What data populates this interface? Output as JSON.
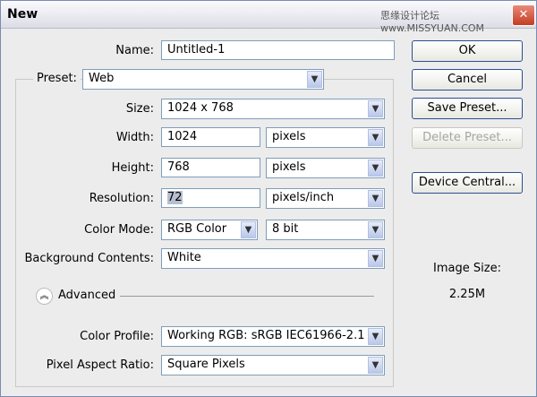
{
  "window": {
    "title": "New",
    "watermark": "思缘设计论坛 www.MISSYUAN.COM",
    "close": "✕"
  },
  "name": {
    "label": "Name:",
    "value": "Untitled-1"
  },
  "preset": {
    "label": "Preset:",
    "value": "Web"
  },
  "size": {
    "label": "Size:",
    "value": "1024 x 768"
  },
  "width": {
    "label": "Width:",
    "value": "1024",
    "unit": "pixels"
  },
  "height": {
    "label": "Height:",
    "value": "768",
    "unit": "pixels"
  },
  "resolution": {
    "label": "Resolution:",
    "value": "72",
    "unit": "pixels/inch"
  },
  "color_mode": {
    "label": "Color Mode:",
    "value": "RGB Color",
    "depth": "8 bit"
  },
  "background": {
    "label": "Background Contents:",
    "value": "White"
  },
  "advanced": {
    "label": "Advanced"
  },
  "color_profile": {
    "label": "Color Profile:",
    "value": "Working RGB:  sRGB IEC61966-2.1"
  },
  "pixel_aspect": {
    "label": "Pixel Aspect Ratio:",
    "value": "Square Pixels"
  },
  "buttons": {
    "ok": "OK",
    "cancel": "Cancel",
    "save_preset": "Save Preset...",
    "delete_preset": "Delete Preset...",
    "device_central": "Device Central..."
  },
  "image_size": {
    "label": "Image Size:",
    "value": "2.25M"
  }
}
